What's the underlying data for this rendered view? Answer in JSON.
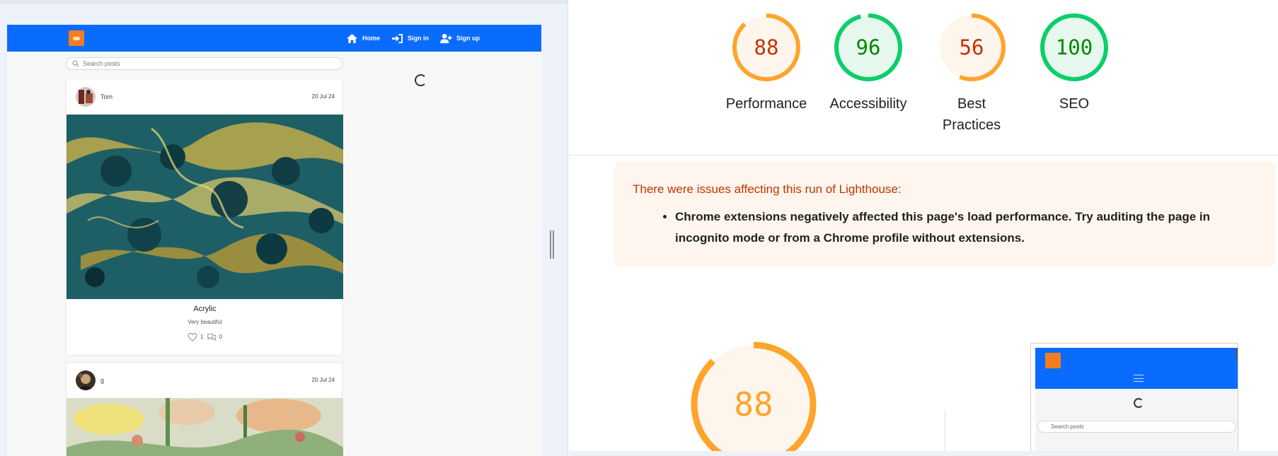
{
  "emulated_page": {
    "nav": {
      "home_label": "Home",
      "signin_label": "Sign in",
      "signup_label": "Sign up"
    },
    "search": {
      "placeholder": "Search posts"
    },
    "posts": [
      {
        "author": "Tom",
        "date": "20 Jul 24",
        "title": "Acrylic",
        "description": "Very beautiful",
        "likes": "1",
        "comments": "0"
      },
      {
        "author": "g",
        "date": "20 Jul 24"
      }
    ]
  },
  "report": {
    "scores": [
      {
        "label": "Performance",
        "score": "88",
        "level": "average"
      },
      {
        "label": "Accessibility",
        "score": "96",
        "level": "pass"
      },
      {
        "label_line1": "Best",
        "label_line2": "Practices",
        "score": "56",
        "level": "average"
      },
      {
        "label": "SEO",
        "score": "100",
        "level": "pass"
      }
    ],
    "warning": {
      "title": "There were issues affecting this run of Lighthouse:",
      "items": [
        "Chrome extensions negatively affected this page's load performance. Try auditing the page in incognito mode or from a Chrome profile without extensions."
      ]
    },
    "big_score": {
      "score": "88"
    },
    "screenshot_preview": {
      "search_placeholder": "Search posts"
    }
  },
  "colors": {
    "nav_blue": "#0a6cff",
    "logo_orange": "#f57c1f",
    "score_average": "#ffa42c",
    "score_pass": "#0cce6b",
    "score_average_text": "#c33300",
    "score_pass_text": "#008800",
    "warning_bg": "#fef6ee"
  }
}
